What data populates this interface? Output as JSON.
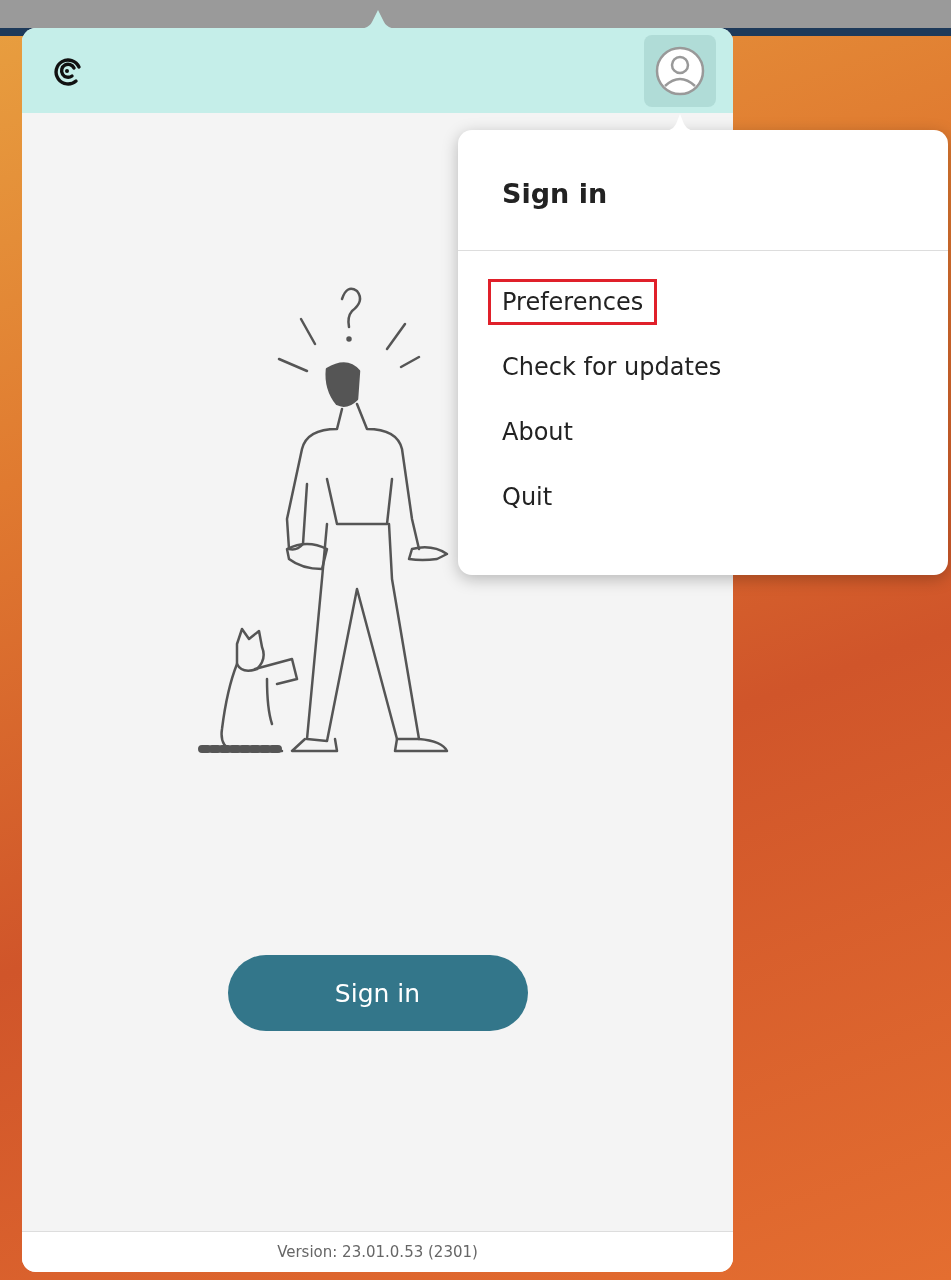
{
  "app_window": {
    "sign_in_button": "Sign in",
    "version": "Version: 23.01.0.53 (2301)"
  },
  "account_menu": {
    "open": true,
    "title": "Sign in",
    "items": [
      {
        "label": "Preferences",
        "highlighted": true
      },
      {
        "label": "Check for updates",
        "highlighted": false
      },
      {
        "label": "About",
        "highlighted": false
      },
      {
        "label": "Quit",
        "highlighted": false
      }
    ]
  }
}
